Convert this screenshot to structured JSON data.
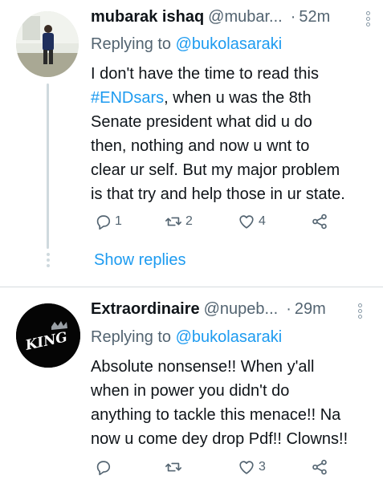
{
  "tweets": [
    {
      "name": "mubarak ishaq",
      "handle": "@mubar...",
      "separator": "·",
      "time": "52m",
      "replying_prefix": "Replying to ",
      "replying_to": "@bukolasaraki",
      "lines": [
        "I don't have the time to read this",
        "#ENDsars",
        ", when u was the 8th",
        "Senate president what did u do",
        "then,  nothing and now u wnt to",
        "clear ur self.  But my major problem",
        "is that try and help those in ur state."
      ],
      "reply_count": "1",
      "retweet_count": "2",
      "like_count": "4",
      "show_replies": "Show replies",
      "icons": [
        "reply-icon",
        "retweet-icon",
        "like-icon",
        "share-icon",
        "more-icon"
      ]
    },
    {
      "name": "Extraordinaire",
      "handle": "@nupeb...",
      "separator": "·",
      "time": "29m",
      "replying_prefix": "Replying to ",
      "replying_to": "@bukolasaraki",
      "lines": [
        "Absolute nonsense!! When y'all",
        "when in power you didn't do",
        "anything to tackle this menace!! Na",
        "now u come dey drop Pdf!! Clowns!!"
      ],
      "reply_count": "",
      "retweet_count": "",
      "like_count": "3",
      "avatar_text": "KING",
      "icons": [
        "reply-icon",
        "retweet-icon",
        "like-icon",
        "share-icon",
        "more-icon"
      ]
    }
  ],
  "colors": {
    "accent": "#1d9bf0",
    "secondary_text": "#536471",
    "primary_text": "#0f1419",
    "divider": "#d6dbdf"
  }
}
